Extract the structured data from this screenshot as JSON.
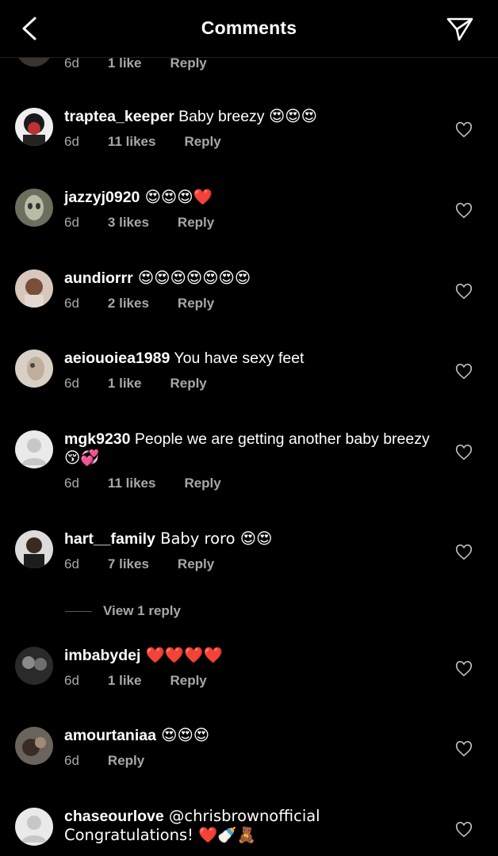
{
  "header": {
    "title": "Comments"
  },
  "partial_comment": {
    "time": "6d",
    "likes": "1 like",
    "reply": "Reply"
  },
  "comments": [
    {
      "username": "traptea_keeper",
      "text": " Baby breezy 😍😍😍",
      "time": "6d",
      "likes": "11 likes",
      "reply": "Reply"
    },
    {
      "username": "jazzyj0920",
      "text": " 😍😍😍❤️",
      "time": "6d",
      "likes": "3 likes",
      "reply": "Reply"
    },
    {
      "username": "aundiorrr",
      "text": " 😍😍😍😍😍😍😍",
      "time": "6d",
      "likes": "2 likes",
      "reply": "Reply"
    },
    {
      "username": "aeiouoiea1989",
      "text": " You have sexy feet",
      "time": "6d",
      "likes": "1 like",
      "reply": "Reply"
    },
    {
      "username": "mgk9230",
      "text": " People we are getting another baby breezy 😚💞",
      "time": "6d",
      "likes": "11 likes",
      "reply": "Reply"
    },
    {
      "username": "hart__family",
      "text": " Baby roro 😍😍",
      "time": "6d",
      "likes": "7 likes",
      "reply": "Reply"
    },
    {
      "username": "imbabydej",
      "text": " ❤️❤️❤️❤️",
      "time": "6d",
      "likes": "1 like",
      "reply": "Reply"
    },
    {
      "username": "amourtaniaa",
      "text": " 😍😍😍",
      "time": "6d",
      "likes": "",
      "reply": "Reply"
    },
    {
      "username": "chaseourlove",
      "text": " @chrisbrownofficial Congratulations! ❤️🍼🧸",
      "time": "",
      "likes": "",
      "reply": ""
    }
  ],
  "view_replies": "View 1 reply",
  "colors": {
    "background": "#000000",
    "text": "#ffffff",
    "meta": "#a8a8a8"
  }
}
